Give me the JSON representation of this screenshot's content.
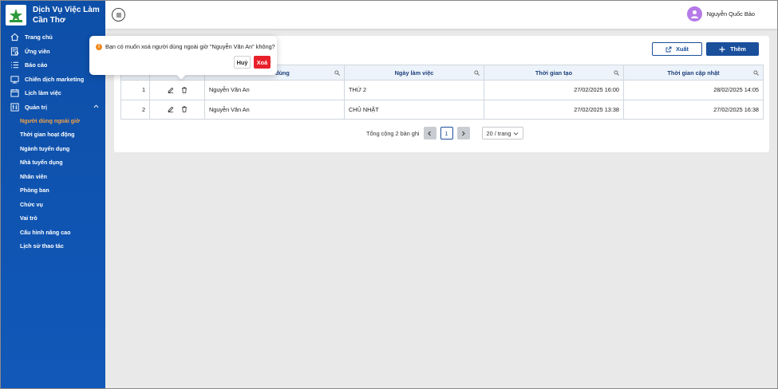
{
  "brand": {
    "name": "Dịch Vụ Việc Làm Cần Thơ",
    "logo": "logo"
  },
  "sidebar": {
    "items": [
      {
        "label": "Trang chủ",
        "icon": "home-icon"
      },
      {
        "label": "Ứng viên",
        "icon": "candidate-icon"
      },
      {
        "label": "Báo cáo",
        "icon": "list-icon"
      },
      {
        "label": "Chiến dịch marketing",
        "icon": "campaign-icon"
      },
      {
        "label": "Lịch làm việc",
        "icon": "calendar-icon"
      },
      {
        "label": "Quản trị",
        "icon": "admin-icon"
      }
    ],
    "admin_sub": [
      "Người dùng ngoài giờ",
      "Thời gian hoạt động",
      "Ngành tuyển dụng",
      "Nhà tuyển dụng",
      "Nhân viên",
      "Phòng ban",
      "Chức vụ",
      "Vai trò",
      "Cấu hình nâng cao",
      "Lịch sử thao tác"
    ],
    "active_color": "#f4a34a"
  },
  "header": {
    "user_name": "Nguyễn Quốc Bảo"
  },
  "toolbar": {
    "export_label": "Xuất",
    "add_label": "Thêm"
  },
  "table": {
    "columns": [
      "",
      "",
      "dùng",
      "Ngày làm việc",
      "Thời gian tạo",
      "Thời gian cập nhật"
    ],
    "rows": [
      {
        "stt": "1",
        "user": "Nguyễn Văn An",
        "day": "THỨ 2",
        "created": "27/02/2025 16:00",
        "updated": "28/02/2025 14:05"
      },
      {
        "stt": "2",
        "user": "Nguyễn Văn An",
        "day": "CHỦ NHẬT",
        "created": "27/02/2025 13:38",
        "updated": "27/02/2025 16:38"
      }
    ]
  },
  "pagination": {
    "total_text": "Tổng cộng 2 bản ghi",
    "current_page": "1",
    "page_size": "20 / trang"
  },
  "popconfirm": {
    "message": "Bạn có muốn xoá người dùng ngoài giờ \"Nguyễn Văn An\" không?",
    "cancel_label": "Huỷ",
    "ok_label": "Xoá",
    "ok_color": "#e8202a"
  },
  "colors": {
    "sidebar": "#0d4fa8",
    "primary": "#1a4f9c",
    "header_cell": "#edf3fa"
  }
}
